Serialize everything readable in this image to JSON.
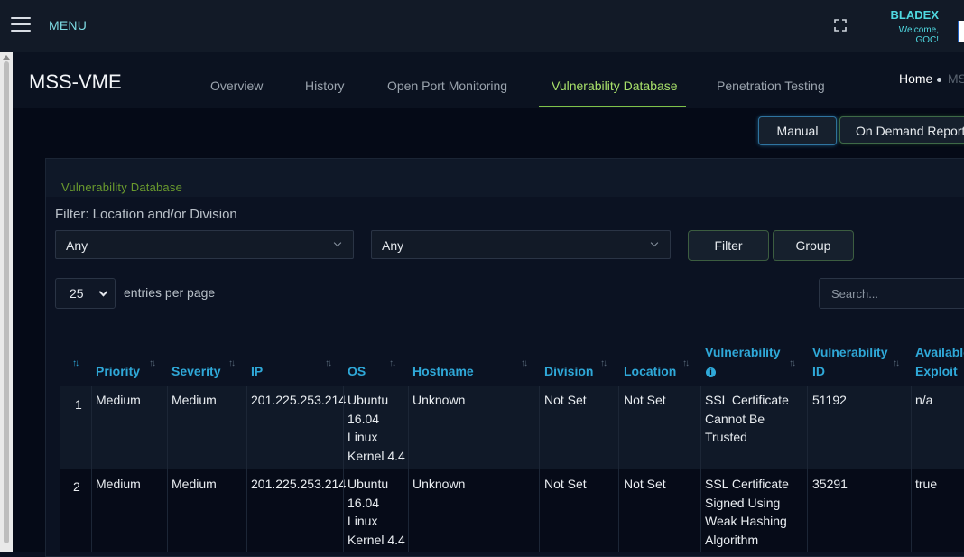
{
  "topbar": {
    "menu_label": "MENU",
    "brand_name": "BLADEX",
    "welcome": "Welcome, GOC!"
  },
  "app_title": "MSS-VME",
  "tabs": [
    {
      "label": "Overview",
      "active": false
    },
    {
      "label": "History",
      "active": false
    },
    {
      "label": "Open Port Monitoring",
      "active": false
    },
    {
      "label": "Vulnerability Database",
      "active": true
    },
    {
      "label": "Penetration Testing",
      "active": false
    }
  ],
  "breadcrumb": {
    "home": "Home",
    "current": "MSS-VME"
  },
  "actions": {
    "manual": "Manual",
    "on_demand_report": "On Demand Report"
  },
  "panel": {
    "title": "Vulnerability Database",
    "filter_label": "Filter: Location and/or Division",
    "location_select": "Any",
    "division_select": "Any",
    "filter_button": "Filter",
    "group_button": "Group",
    "per_page_value": "25",
    "per_page_label": "entries per page",
    "search_placeholder": "Search..."
  },
  "table": {
    "columns": [
      "",
      "Priority",
      "Severity",
      "IP",
      "OS",
      "Hostname",
      "Division",
      "Location",
      "Vulnerability",
      "Vulnerability ID",
      "Available Exploit"
    ],
    "rows": [
      {
        "num": "1",
        "priority": "Medium",
        "severity": "Medium",
        "ip": "201.225.253.214",
        "os": "Ubuntu 16.04 Linux Kernel 4.4",
        "hostname": "Unknown",
        "division": "Not Set",
        "location": "Not Set",
        "vulnerability": "SSL Certificate Cannot Be Trusted",
        "vuln_id": "51192",
        "exploit": "n/a"
      },
      {
        "num": "2",
        "priority": "Medium",
        "severity": "Medium",
        "ip": "201.225.253.214",
        "os": "Ubuntu 16.04 Linux Kernel 4.4",
        "hostname": "Unknown",
        "division": "Not Set",
        "location": "Not Set",
        "vulnerability": "SSL Certificate Signed Using Weak Hashing Algorithm",
        "vuln_id": "35291",
        "exploit": "true"
      }
    ]
  },
  "colors": {
    "accent_green": "#a8e06a",
    "header_blue": "#2fa8d8",
    "menu_cyan": "#7ddbe3"
  }
}
